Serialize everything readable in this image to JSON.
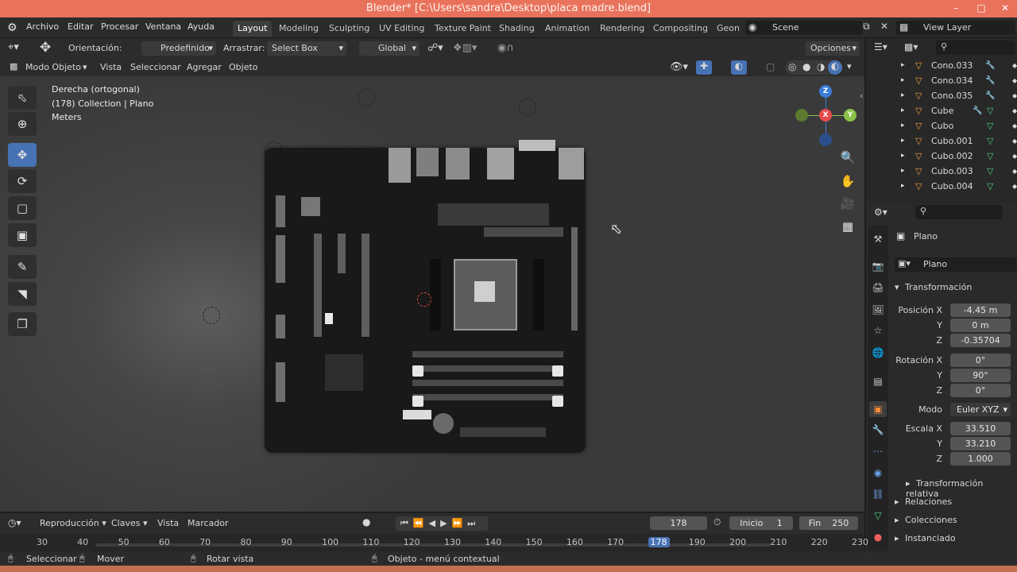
{
  "window": {
    "title": "Blender* [C:\\Users\\sandra\\Desktop\\placa madre.blend]"
  },
  "menu": [
    "Archivo",
    "Editar",
    "Procesar",
    "Ventana",
    "Ayuda"
  ],
  "workspaces": [
    "Layout",
    "Modeling",
    "Sculpting",
    "UV Editing",
    "Texture Paint",
    "Shading",
    "Animation",
    "Rendering",
    "Compositing",
    "Geon"
  ],
  "scene": "Scene",
  "view_layer": "View Layer",
  "tool_header": {
    "orientation_label": "Orientación:",
    "orientation_value": "Predefinido",
    "drag_label": "Arrastrar:",
    "drag_value": "Select Box",
    "transform_space": "Global",
    "options": "Opciones"
  },
  "view_header": {
    "mode": "Modo Objeto",
    "items": [
      "Vista",
      "Seleccionar",
      "Agregar",
      "Objeto"
    ]
  },
  "viewport": {
    "view_name": "Derecha (ortogonal)",
    "collection": "(178) Collection | Plano",
    "units": "Meters"
  },
  "outliner": {
    "items": [
      {
        "name": "Cono.033",
        "mod": "wrench"
      },
      {
        "name": "Cono.034",
        "mod": "wrench"
      },
      {
        "name": "Cono.035",
        "mod": "wrench"
      },
      {
        "name": "Cube",
        "mod": "both"
      },
      {
        "name": "Cubo",
        "mod": "mesh"
      },
      {
        "name": "Cubo.001",
        "mod": "mesh"
      },
      {
        "name": "Cubo.002",
        "mod": "mesh"
      },
      {
        "name": "Cubo.003",
        "mod": "mesh"
      },
      {
        "name": "Cubo.004",
        "mod": "mesh"
      }
    ]
  },
  "properties": {
    "object_name": "Plano",
    "data_name": "Plano",
    "transform_title": "Transformación",
    "position_label": "Posición X",
    "position": {
      "x": "-4.45 m",
      "y": "0 m",
      "z": "-0.35704"
    },
    "rotation_label": "Rotación X",
    "rotation": {
      "x": "0°",
      "y": "90°",
      "z": "0°"
    },
    "mode_label": "Modo",
    "mode_value": "Euler XYZ",
    "scale_label": "Escala X",
    "scale": {
      "x": "33.510",
      "y": "33.210",
      "z": "1.000"
    },
    "axis_y": "Y",
    "axis_z": "Z",
    "relative_transform": "Transformación relativa",
    "relations": "Relaciones",
    "collections": "Colecciones",
    "instancing": "Instanciado"
  },
  "timeline": {
    "playback": "Reproducción",
    "keys": "Claves",
    "view": "Vista",
    "marker": "Marcador",
    "current_frame": "178",
    "start_label": "Inicio",
    "start": "1",
    "end_label": "Fin",
    "end": "250",
    "ticks": [
      "30",
      "40",
      "50",
      "60",
      "70",
      "80",
      "90",
      "100",
      "110",
      "120",
      "130",
      "140",
      "150",
      "160",
      "170",
      "178",
      "190",
      "200",
      "210",
      "220",
      "230"
    ]
  },
  "statusbar": {
    "select": "Seleccionar",
    "move": "Mover",
    "rotate_view": "Rotar vista",
    "context_menu": "Objeto - menú contextual"
  },
  "colors": {
    "accent": "#4772b3",
    "title_bar": "#e9725c",
    "axis_x": "#e84b4b",
    "axis_y": "#8bc34a",
    "axis_z": "#3b7bd9",
    "outliner_icon": "#f0a040",
    "mesh_icon": "#4cd27a"
  }
}
